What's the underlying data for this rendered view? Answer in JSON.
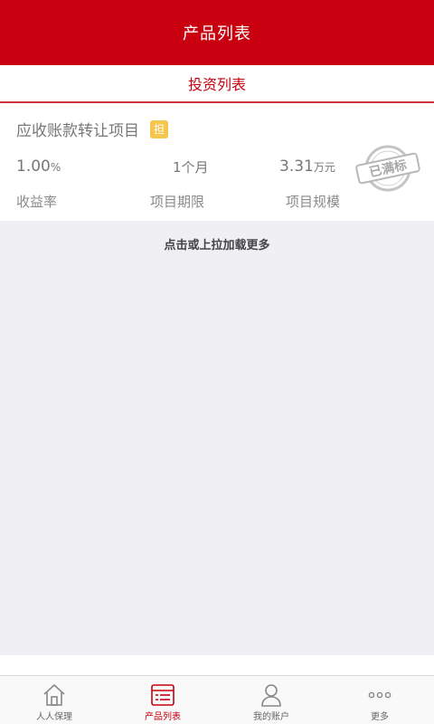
{
  "header": {
    "title": "产品列表"
  },
  "subtab": {
    "label": "投资列表"
  },
  "product": {
    "name": "应收账款转让项目",
    "badge": "担",
    "rate_value": "1.00",
    "rate_unit": "%",
    "term_value": "1",
    "term_unit": "个月",
    "size_value": "3.31",
    "size_unit": "万元",
    "rate_label": "收益率",
    "term_label": "项目期限",
    "size_label": "项目规模",
    "stamp_text": "已满标"
  },
  "load_more": {
    "text": "点击或上拉加载更多"
  },
  "tabbar": {
    "items": [
      {
        "label": "人人保理",
        "icon": "home-icon",
        "active": false
      },
      {
        "label": "产品列表",
        "icon": "list-icon",
        "active": true
      },
      {
        "label": "我的账户",
        "icon": "user-icon",
        "active": false
      },
      {
        "label": "更多",
        "icon": "more-icon",
        "active": false
      }
    ]
  },
  "colors": {
    "brand_red": "#c9000f",
    "badge_yellow": "#f6c54b",
    "stamp_gray": "#bcbcbc"
  }
}
